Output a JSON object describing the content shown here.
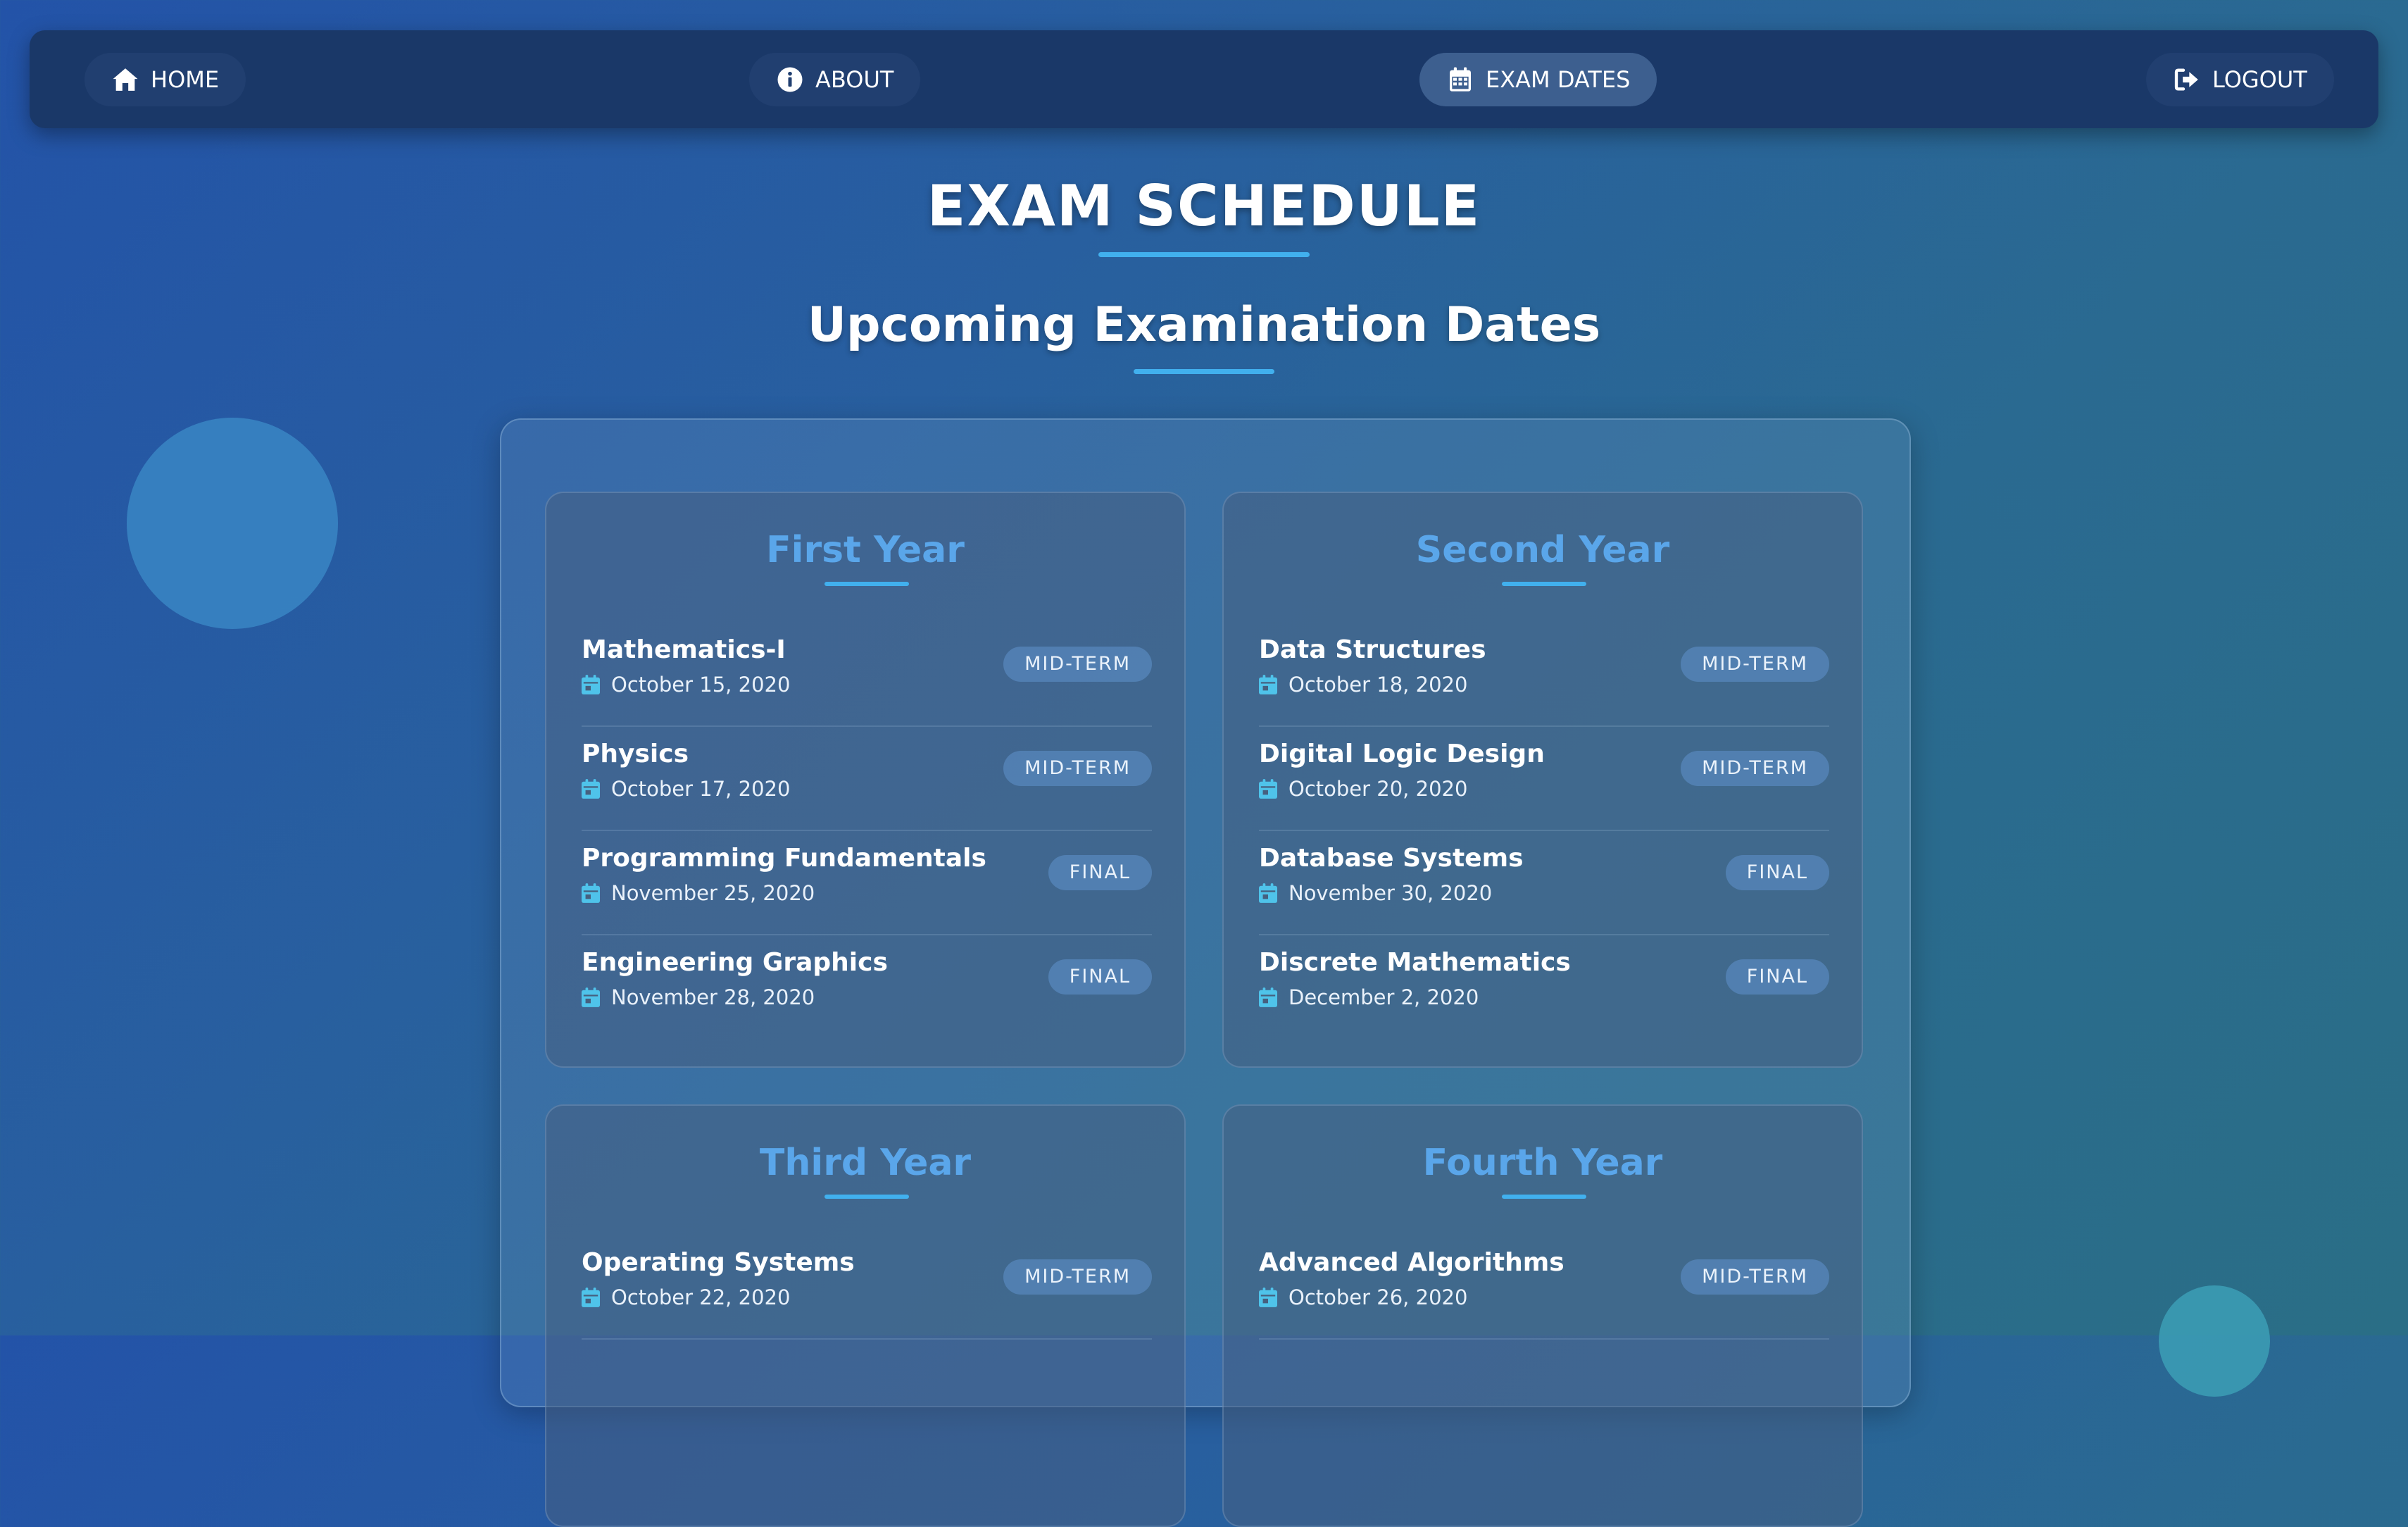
{
  "nav": {
    "items": [
      {
        "label": "HOME",
        "icon": "home-icon"
      },
      {
        "label": "ABOUT",
        "icon": "info-icon"
      },
      {
        "label": "EXAM DATES",
        "icon": "calendar-icon",
        "active": true
      },
      {
        "label": "LOGOUT",
        "icon": "logout-icon"
      }
    ]
  },
  "page": {
    "title": "EXAM SCHEDULE",
    "subtitle": "Upcoming Examination Dates"
  },
  "colors": {
    "accent": "#41b0ee",
    "card_title": "#5aa6ea",
    "navbar": "#1a3868",
    "calendar_icon": "#4fc3ea"
  },
  "years": [
    {
      "title": "First Year",
      "exams": [
        {
          "subject": "Mathematics-I",
          "date": "October 15, 2020",
          "type": "MID-TERM"
        },
        {
          "subject": "Physics",
          "date": "October 17, 2020",
          "type": "MID-TERM"
        },
        {
          "subject": "Programming Fundamentals",
          "date": "November 25, 2020",
          "type": "FINAL"
        },
        {
          "subject": "Engineering Graphics",
          "date": "November 28, 2020",
          "type": "FINAL"
        }
      ]
    },
    {
      "title": "Second Year",
      "exams": [
        {
          "subject": "Data Structures",
          "date": "October 18, 2020",
          "type": "MID-TERM"
        },
        {
          "subject": "Digital Logic Design",
          "date": "October 20, 2020",
          "type": "MID-TERM"
        },
        {
          "subject": "Database Systems",
          "date": "November 30, 2020",
          "type": "FINAL"
        },
        {
          "subject": "Discrete Mathematics",
          "date": "December 2, 2020",
          "type": "FINAL"
        }
      ]
    },
    {
      "title": "Third Year",
      "exams": [
        {
          "subject": "Operating Systems",
          "date": "October 22, 2020",
          "type": "MID-TERM"
        }
      ]
    },
    {
      "title": "Fourth Year",
      "exams": [
        {
          "subject": "Advanced Algorithms",
          "date": "October 26, 2020",
          "type": "MID-TERM"
        }
      ]
    }
  ]
}
